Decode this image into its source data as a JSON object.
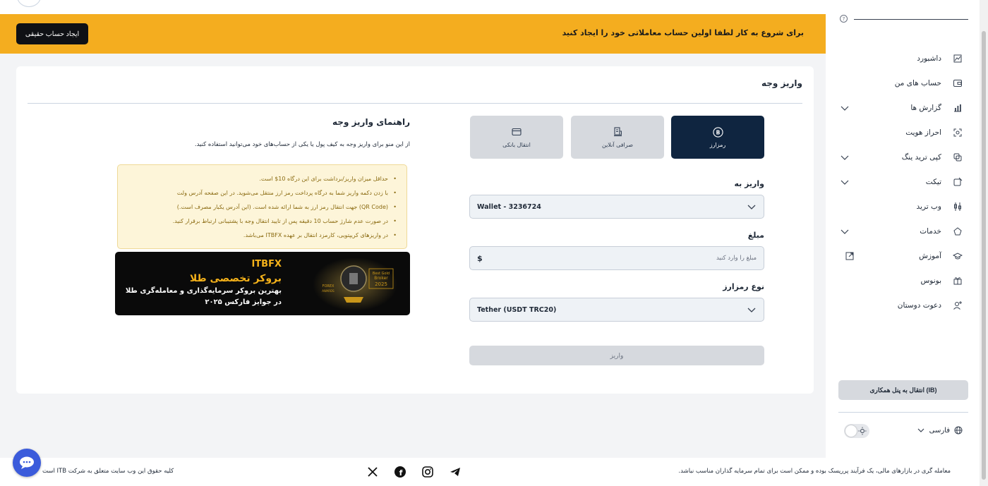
{
  "banner": {
    "message": "برای شروع به کار لطفا اولین حساب معاملاتی خود را ایجاد کنید",
    "create_account": "ایجاد حساب حقیقی"
  },
  "deposit": {
    "title": "واریز وجه",
    "methods": [
      {
        "label": "رمزارز",
        "icon": "bitcoin-icon",
        "active": true
      },
      {
        "label": "صرافی آنلاین",
        "icon": "exchange-icon",
        "active": false
      },
      {
        "label": "انتقال بانکی",
        "icon": "card-icon",
        "active": false
      }
    ],
    "deposit_to_label": "واریز به",
    "deposit_to_value": "Wallet - 3236724",
    "amount_label": "مبلغ",
    "amount_placeholder": "مبلغ را وارد کنید",
    "currency_symbol": "$",
    "crypto_type_label": "نوع رمزارز",
    "crypto_type_value": "Tether (USDT TRC20)",
    "submit": "واریز"
  },
  "guide": {
    "title": "راهنمای واریز وجه",
    "subtitle": "از این منو برای واریز وجه به کیف پول یا یکی از حساب‌های خود می‌توانید استفاده کنید.",
    "notes": [
      "حداقل میزان واریز/برداشت برای این درگاه 10$ است.",
      "با زدن دکمه واریز شما به درگاه پرداخت رمز ارز منتقل می‌شوید. در این صفحه آدرس ولت",
      "(QR Code) جهت انتقال رمز ارز به شما ارائه شده است. (این آدرس یکبار مصرف است.)",
      "در صورت عدم شارژ حساب 10 دقیقه پس از تایید انتقال وجه با پشتیبانی ارتباط برقرار کنید.",
      "در واریزهای کریپتویی، کارمزد انتقال بر عهده ITBFX می‌باشد."
    ]
  },
  "promo": {
    "brand": "ITBFX",
    "line1": "بروکر تخصصی طلا",
    "line2": "بهترین بروکر سرمایه‌گذاری و معامله‌گری طلا",
    "line3": "در جوایز فارکس ۲۰۲۵",
    "award_text": "Best Gold Broker 2025",
    "award_sub": "FOREX AWARDS"
  },
  "sidebar": {
    "items": [
      {
        "label": "داشبورد",
        "icon": "dashboard-icon",
        "chevron": false,
        "external": false
      },
      {
        "label": "حساب های من",
        "icon": "wallet-icon",
        "chevron": false,
        "external": false
      },
      {
        "label": "گزارش ها",
        "icon": "chart-icon",
        "chevron": true,
        "external": false
      },
      {
        "label": "احراز هویت",
        "icon": "face-scan-icon",
        "chevron": false,
        "external": false
      },
      {
        "label": "کپی ترید ینگ",
        "icon": "copy-icon",
        "chevron": true,
        "external": false
      },
      {
        "label": "تیکت",
        "icon": "ticket-icon",
        "chevron": true,
        "external": false
      },
      {
        "label": "وب ترید",
        "icon": "candles-icon",
        "chevron": false,
        "external": false
      },
      {
        "label": "خدمات",
        "icon": "services-icon",
        "chevron": true,
        "external": false
      },
      {
        "label": "آموزش",
        "icon": "graduation-icon",
        "chevron": false,
        "external": true
      },
      {
        "label": "بونوس",
        "icon": "gift-icon",
        "chevron": false,
        "external": false
      },
      {
        "label": "دعوت دوستان",
        "icon": "add-user-icon",
        "chevron": false,
        "external": false
      }
    ],
    "ib_button": "انتقال به پنل همکاری (IB)",
    "language": "فارسی"
  },
  "footer": {
    "disclaimer": "معامله گری در بازارهای مالی، یک فرآیند پرریسک بوده و ممکن است برای تمام سرمایه گذاران مناسب نباشد.",
    "copyright": "کلیه حقوق این وب سایت متعلق به شرکت ITB است",
    "social": [
      "x-icon",
      "facebook-icon",
      "instagram-icon",
      "telegram-icon"
    ]
  },
  "colors": {
    "banner": "#f4ad1f",
    "active_tab": "#0f2540",
    "notice_bg": "#fdf5d9",
    "promo_gold": "#f5b21a"
  }
}
